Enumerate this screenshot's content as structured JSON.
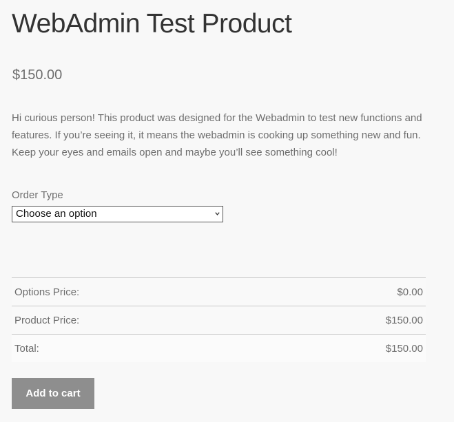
{
  "product": {
    "title": "WebAdmin Test Product",
    "price": "$150.00",
    "description": "Hi curious person! This product was designed for the Webadmin to test new functions and features. If you’re seeing it, it means the webadmin is cooking up something new and fun. Keep your eyes and emails open and maybe you’ll see something cool!"
  },
  "order_type": {
    "label": "Order Type",
    "selected": "Choose an option"
  },
  "totals": {
    "rows": [
      {
        "label": "Options Price:",
        "value": "$0.00"
      },
      {
        "label": "Product Price:",
        "value": "$150.00"
      },
      {
        "label": "Total:",
        "value": "$150.00"
      }
    ]
  },
  "cart": {
    "button_label": "Add to cart"
  },
  "icons": {
    "select_arrow": "chevron-down-icon"
  },
  "colors": {
    "background": "#f8f8f8",
    "button": "#8e8e8e",
    "title": "#333333",
    "text": "#6d6d6d"
  }
}
